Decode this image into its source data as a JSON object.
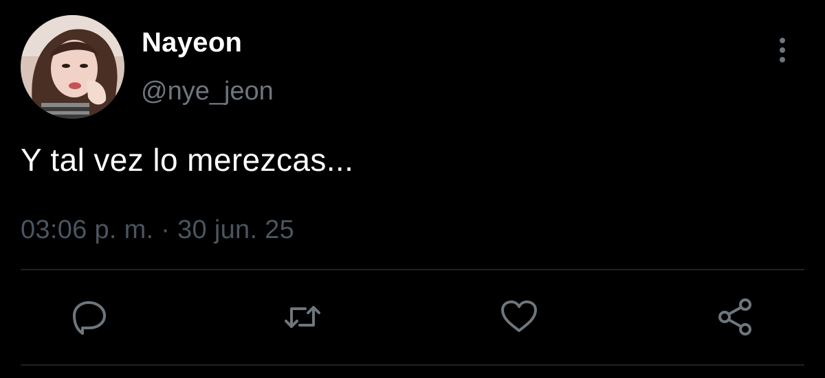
{
  "tweet": {
    "author": {
      "display_name": "Nayeon",
      "handle": "@nye_jeon"
    },
    "text": "Y tal vez lo merezcas...",
    "time": "03:06 p. m.",
    "separator": "·",
    "date": "30 jun. 25"
  },
  "actions": [
    {
      "name": "reply",
      "icon": "speech-bubble-icon"
    },
    {
      "name": "retweet",
      "icon": "retweet-arrows-icon"
    },
    {
      "name": "like",
      "icon": "heart-icon"
    },
    {
      "name": "share",
      "icon": "share-nodes-icon"
    }
  ],
  "menu": {
    "icon": "vertical-ellipsis-icon"
  },
  "colors": {
    "background": "#000000",
    "text_primary": "#ffffff",
    "text_secondary": "#6e767d",
    "timestamp": "#4b5560",
    "icon": "#6e767d",
    "divider": "#1f2327"
  }
}
